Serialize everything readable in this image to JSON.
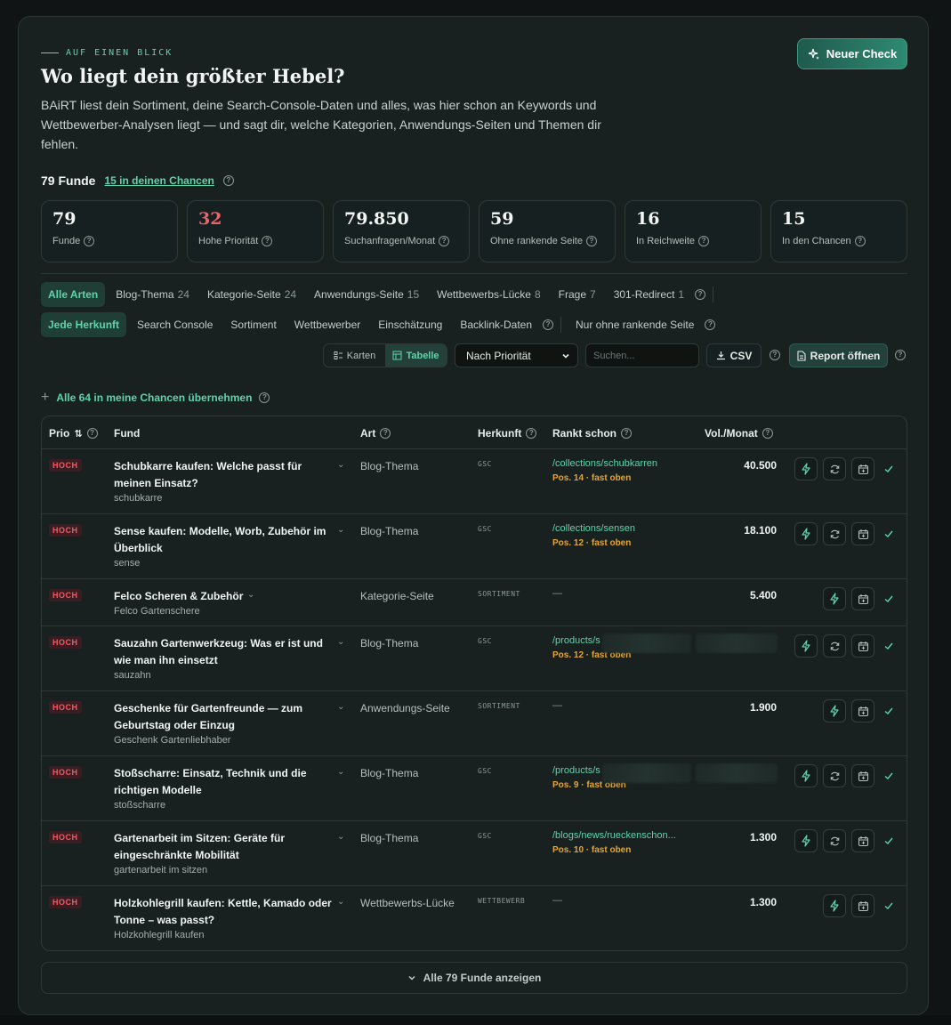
{
  "header": {
    "eyebrow": "AUF EINEN BLICK",
    "title": "Wo liegt dein größter Hebel?",
    "description": "BAiRT liest dein Sortiment, deine Search-Console-Daten und alles, was hier schon an Keywords und Wettbewerber-Analysen liegt — und sagt dir, welche Kategorien, Anwendungs-Seiten und Themen dir fehlen.",
    "new_check_label": "Neuer Check"
  },
  "summary": {
    "count_label": "79 Funde",
    "chances_link": "15 in deinen Chancen"
  },
  "stats": [
    {
      "value": "79",
      "label": "Funde",
      "red": false
    },
    {
      "value": "32",
      "label": "Hohe Priorität",
      "red": true
    },
    {
      "value": "79.850",
      "label": "Suchanfragen/Monat",
      "red": false
    },
    {
      "value": "59",
      "label": "Ohne rankende Seite",
      "red": false
    },
    {
      "value": "16",
      "label": "In Reichweite",
      "red": false
    },
    {
      "value": "15",
      "label": "In den Chancen",
      "red": false
    }
  ],
  "type_filters": [
    {
      "label": "Alle Arten",
      "count": "",
      "active": true
    },
    {
      "label": "Blog-Thema",
      "count": "24",
      "active": false
    },
    {
      "label": "Kategorie-Seite",
      "count": "24",
      "active": false
    },
    {
      "label": "Anwendungs-Seite",
      "count": "15",
      "active": false
    },
    {
      "label": "Wettbewerbs-Lücke",
      "count": "8",
      "active": false
    },
    {
      "label": "Frage",
      "count": "7",
      "active": false
    },
    {
      "label": "301-Redirect",
      "count": "1",
      "active": false
    }
  ],
  "source_filters": [
    {
      "label": "Jede Herkunft",
      "active": true
    },
    {
      "label": "Search Console",
      "active": false
    },
    {
      "label": "Sortiment",
      "active": false
    },
    {
      "label": "Wettbewerber",
      "active": false
    },
    {
      "label": "Einschätzung",
      "active": false
    },
    {
      "label": "Backlink-Daten",
      "active": false
    }
  ],
  "only_unranked_label": "Nur ohne rankende Seite",
  "toolbar": {
    "view_cards": "Karten",
    "view_table": "Tabelle",
    "sort_value": "Nach Priorität",
    "search_placeholder": "Suchen...",
    "csv_label": "CSV",
    "report_label": "Report öffnen"
  },
  "adopt_all_label": "Alle 64 in meine Chancen übernehmen",
  "table": {
    "headers": {
      "prio": "Prio",
      "fund": "Fund",
      "art": "Art",
      "herkunft": "Herkunft",
      "rankt": "Rankt schon",
      "vol": "Vol./Monat"
    },
    "rows": [
      {
        "prio": "HOCH",
        "title": "Schubkarre kaufen: Welche passt für meinen Einsatz?",
        "keyword": "schubkarre",
        "art": "Blog-Thema",
        "source": "GSC",
        "url": "/collections/schubkarren",
        "pos": "Pos. 14 · fast oben",
        "vol": "40.500",
        "refresh": true,
        "redacted": false
      },
      {
        "prio": "HOCH",
        "title": "Sense kaufen: Modelle, Worb, Zubehör im Überblick",
        "keyword": "sense",
        "art": "Blog-Thema",
        "source": "GSC",
        "url": "/collections/sensen",
        "pos": "Pos. 12 · fast oben",
        "vol": "18.100",
        "refresh": true,
        "redacted": false
      },
      {
        "prio": "HOCH",
        "title": "Felco Scheren & Zubehör",
        "keyword": "Felco Gartenschere",
        "art": "Kategorie-Seite",
        "source": "SORTIMENT",
        "url": "",
        "pos": "",
        "vol": "5.400",
        "refresh": false,
        "redacted": false,
        "short": true
      },
      {
        "prio": "HOCH",
        "title": "Sauzahn Gartenwerkzeug: Was er ist und wie man ihn einsetzt",
        "keyword": "sauzahn",
        "art": "Blog-Thema",
        "source": "GSC",
        "url": "/products/s",
        "pos": "Pos. 12 · fast oben",
        "vol": "",
        "refresh": true,
        "redacted": true
      },
      {
        "prio": "HOCH",
        "title": "Geschenke für Gartenfreunde — zum Geburtstag oder Einzug",
        "keyword": "Geschenk Gartenliebhaber",
        "art": "Anwendungs-Seite",
        "source": "SORTIMENT",
        "url": "",
        "pos": "",
        "vol": "1.900",
        "refresh": false,
        "redacted": false
      },
      {
        "prio": "HOCH",
        "title": "Stoßscharre: Einsatz, Technik und die richtigen Modelle",
        "keyword": "stoßscharre",
        "art": "Blog-Thema",
        "source": "GSC",
        "url": "/products/s",
        "pos": "Pos. 9 · fast oben",
        "vol": "",
        "refresh": true,
        "redacted": true
      },
      {
        "prio": "HOCH",
        "title": "Gartenarbeit im Sitzen: Geräte für eingeschränkte Mobilität",
        "keyword": "gartenarbeit im sitzen",
        "art": "Blog-Thema",
        "source": "GSC",
        "url": "/blogs/news/rueckenschon...",
        "pos": "Pos. 10 · fast oben",
        "vol": "1.300",
        "refresh": true,
        "redacted": false
      },
      {
        "prio": "HOCH",
        "title": "Holzkohlegrill kaufen: Kettle, Kamado oder Tonne – was passt?",
        "keyword": "Holzkohlegrill kaufen",
        "art": "Wettbewerbs-Lücke",
        "source": "WETTBEWERB",
        "url": "",
        "pos": "",
        "vol": "1.300",
        "refresh": false,
        "redacted": false
      }
    ]
  },
  "show_all_label": "Alle 79 Funde anzeigen",
  "colors": {
    "accent": "#5fd3a9",
    "danger": "#ee5b63",
    "warning": "#e2a63a",
    "background": "#182120"
  }
}
